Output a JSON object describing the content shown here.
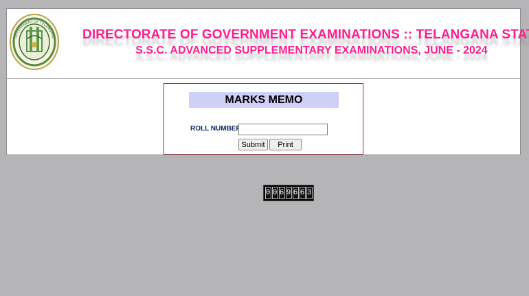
{
  "header": {
    "logo_text_top": "GOVERNMENT OF TELANGANA",
    "title": "DIRECTORATE OF GOVERNMENT EXAMINATIONS :: TELANGANA STATE",
    "subtitle": "S.S.C. ADVANCED SUPPLEMENTARY EXAMINATIONS, JUNE - 2024"
  },
  "form": {
    "heading": "MARKS MEMO",
    "roll_label": "ROLL NUMBER",
    "roll_value": "",
    "submit_label": "Submit",
    "print_label": "Print"
  },
  "counter": {
    "digits": [
      "0",
      "0",
      "6",
      "9",
      "6",
      "6",
      "3"
    ]
  },
  "colors": {
    "title": "#ff1d8e",
    "memo_heading_bg": "#cfcff9",
    "memo_border": "#9b2a2e",
    "page_bg": "#b5b5b8"
  },
  "icons": {
    "logo": "telangana-emblem-icon"
  }
}
